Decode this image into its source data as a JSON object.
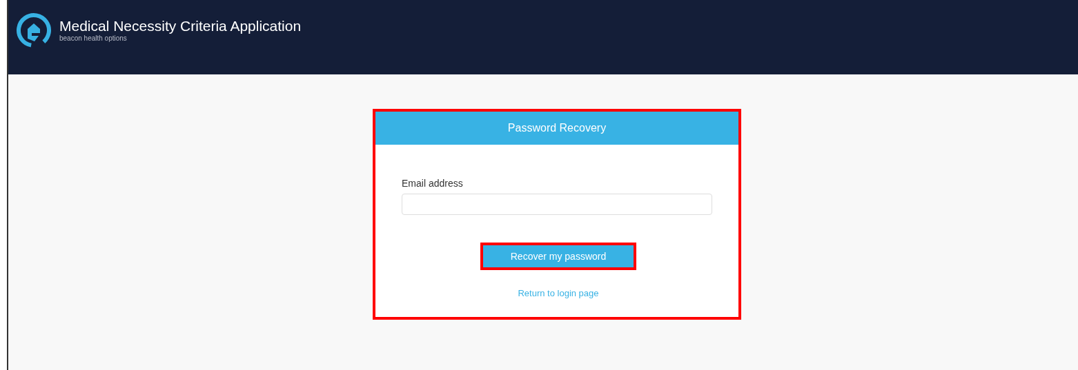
{
  "header": {
    "title": "Medical Necessity Criteria Application",
    "subtitle": "beacon health options"
  },
  "panel": {
    "title": "Password Recovery",
    "highlighted": true,
    "email": {
      "label": "Email address"
    },
    "submit": {
      "label": "Recover my password",
      "highlighted": true
    },
    "link": "Return to login page"
  }
}
